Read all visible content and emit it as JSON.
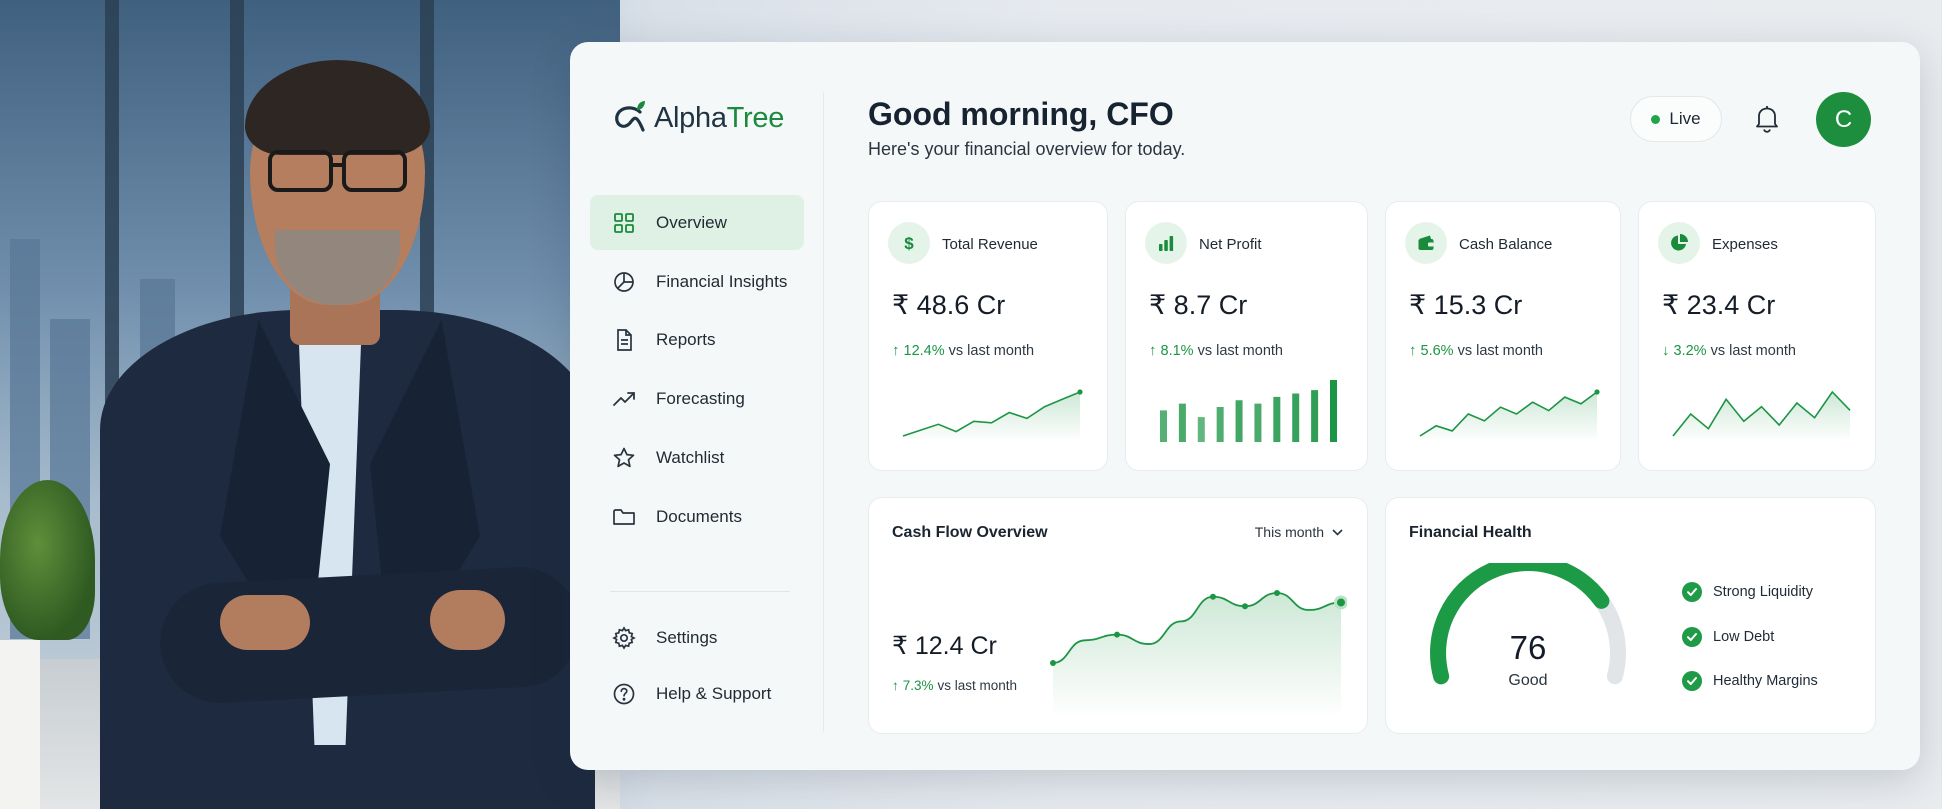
{
  "brand": {
    "name_part1": "Alpha",
    "name_part2": "Tree",
    "accent": "#1a8a3c"
  },
  "sidebar": {
    "items": [
      {
        "label": "Overview",
        "icon": "grid-icon",
        "active": true
      },
      {
        "label": "Financial Insights",
        "icon": "pie-chart-icon"
      },
      {
        "label": "Reports",
        "icon": "document-icon"
      },
      {
        "label": "Forecasting",
        "icon": "trend-up-icon"
      },
      {
        "label": "Watchlist",
        "icon": "star-icon"
      },
      {
        "label": "Documents",
        "icon": "folder-icon"
      }
    ],
    "footer_items": [
      {
        "label": "Settings",
        "icon": "gear-icon"
      },
      {
        "label": "Help & Support",
        "icon": "help-icon"
      }
    ]
  },
  "header": {
    "title": "Good morning, CFO",
    "subtitle": "Here's your financial overview for today.",
    "live_label": "Live",
    "avatar_initial": "C"
  },
  "kpis": [
    {
      "label": "Total Revenue",
      "value": "₹ 48.6 Cr",
      "change_pct": "12.4%",
      "change_text": "vs last month",
      "direction": "up",
      "icon": "rupee-icon",
      "spark_type": "line",
      "spark": [
        10,
        14,
        18,
        13,
        20,
        19,
        26,
        22,
        30,
        35,
        40
      ]
    },
    {
      "label": "Net Profit",
      "value": "₹ 8.7 Cr",
      "change_pct": "8.1%",
      "change_text": "vs last month",
      "direction": "up",
      "icon": "bar-chart-icon",
      "spark_type": "bar",
      "spark": [
        35,
        45,
        25,
        40,
        50,
        45,
        55,
        60,
        65,
        80
      ]
    },
    {
      "label": "Cash Balance",
      "value": "₹ 15.3 Cr",
      "change_pct": "5.6%",
      "change_text": "vs last month",
      "direction": "up",
      "icon": "wallet-icon",
      "spark_type": "line",
      "spark": [
        14,
        20,
        17,
        27,
        23,
        31,
        27,
        34,
        29,
        37,
        33,
        40
      ]
    },
    {
      "label": "Expenses",
      "value": "₹ 23.4 Cr",
      "change_pct": "3.2%",
      "change_text": "vs last month",
      "direction": "down",
      "icon": "pie-chart-icon",
      "spark_type": "line",
      "spark": [
        20,
        26,
        22,
        30,
        24,
        28,
        23,
        29,
        25,
        32,
        27
      ]
    }
  ],
  "cash_flow": {
    "title": "Cash Flow Overview",
    "period": "This month",
    "value": "₹ 12.4 Cr",
    "change_pct": "7.3%",
    "change_text": "vs last month",
    "series": [
      20,
      32,
      35,
      30,
      42,
      55,
      50,
      57,
      48,
      52
    ]
  },
  "financial_health": {
    "title": "Financial Health",
    "score": "76",
    "score_fraction": 0.76,
    "rating": "Good",
    "items": [
      "Strong Liquidity",
      "Low Debt",
      "Healthy Margins"
    ]
  }
}
